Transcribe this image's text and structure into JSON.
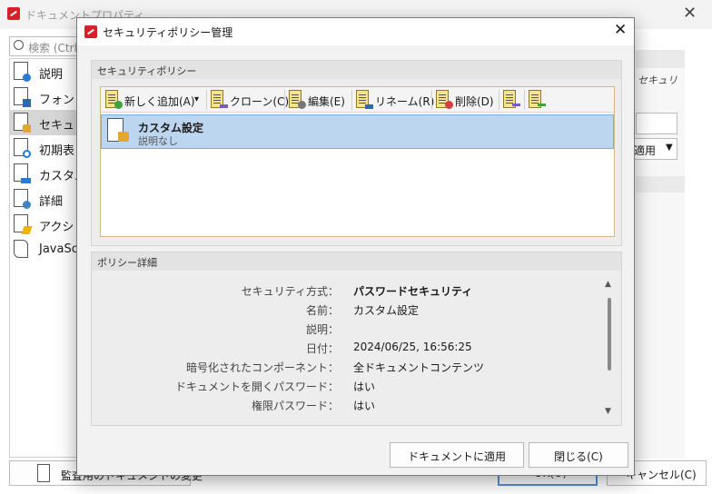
{
  "background_window": {
    "title": "ドキュメントプロパティ",
    "search_placeholder": "検索 (Ctrl+",
    "nav_items": [
      {
        "label": "説明",
        "icon": "document-info-icon"
      },
      {
        "label": "フォント",
        "icon": "document-font-icon"
      },
      {
        "label": "セキュリ",
        "icon": "document-lock-icon",
        "selected": true
      },
      {
        "label": "初期表",
        "icon": "document-search-icon"
      },
      {
        "label": "カスタム",
        "icon": "document-custom-icon"
      },
      {
        "label": "詳細",
        "icon": "document-gear-icon"
      },
      {
        "label": "アクショ",
        "icon": "document-lightning-icon"
      },
      {
        "label": "JavaSc",
        "icon": "script-icon"
      }
    ],
    "right_panel": {
      "section_label": "セキュリ",
      "combo_value": "適用"
    },
    "buttons": {
      "audit": "監査用のドキュメントの変更",
      "ok": "OK(O)",
      "cancel": "キャンセル(C)"
    }
  },
  "dialog": {
    "title": "セキュリティポリシー管理",
    "policies_group_title": "セキュリティポリシー",
    "toolbar": {
      "new_label": "新しく追加(A)",
      "clone_label": "クローン(C)",
      "edit_label": "編集(E)",
      "rename_label": "リネーム(R)",
      "delete_label": "削除(D)"
    },
    "policies": [
      {
        "name": "カスタム設定",
        "description": "説明なし"
      }
    ],
    "details_group_title": "ポリシー詳細",
    "details": [
      {
        "label": "セキュリティ方式：",
        "value": "パスワードセキュリティ"
      },
      {
        "label": "名前：",
        "value": "カスタム設定"
      },
      {
        "label": "説明：",
        "value": ""
      },
      {
        "label": "日付：",
        "value": "2024/06/25, 16:56:25"
      },
      {
        "label": "暗号化されたコンポーネント：",
        "value": "全ドキュメントコンテンツ"
      },
      {
        "label": "ドキュメントを開くパスワード：",
        "value": "はい"
      },
      {
        "label": "権限パスワード：",
        "value": "はい"
      }
    ],
    "buttons": {
      "apply": "ドキュメントに適用",
      "close": "閉じる(C)"
    }
  },
  "colors": {
    "accent": "#5a8fd6",
    "selection": "#bcd6f0",
    "pdf_red": "#d6202a",
    "add_green": "#3da33d",
    "delete_red": "#d94040",
    "lock_orange": "#e0a733"
  }
}
